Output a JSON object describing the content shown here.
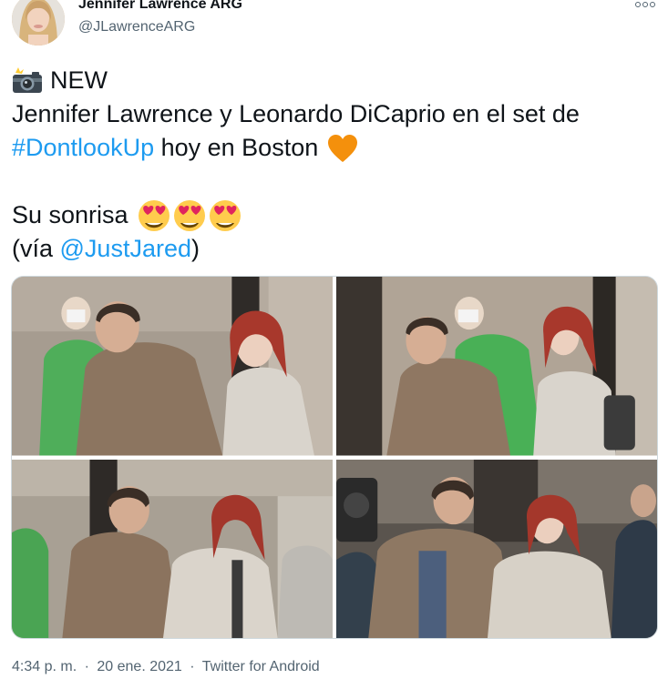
{
  "author": {
    "display_name": "Jennifer Lawrence ARG",
    "handle": "@JLawrenceARG"
  },
  "tweet": {
    "line1_text": "NEW",
    "line2_text": "Jennifer Lawrence y Leonardo DiCaprio en el set de",
    "line3_hashtag": "#DontlookUp",
    "line3_text": " hoy en Boston",
    "line4_text": "Su sonrisa",
    "line5_prefix": "(vía ",
    "line5_mention": "@JustJared",
    "line5_suffix": ")"
  },
  "icons": {
    "camera": "camera-with-flash-icon",
    "heart": "orange-heart-icon",
    "heart_eyes": "heart-eyes-emoji-icon",
    "more": "more-options-icon"
  },
  "colors": {
    "link": "#1d9bf0",
    "orange_heart": "#f4900c",
    "secondary_text": "#536471"
  },
  "meta": {
    "time": "4:34 p. m.",
    "date": "20 ene. 2021",
    "source": "Twitter for Android",
    "separator": "·"
  }
}
